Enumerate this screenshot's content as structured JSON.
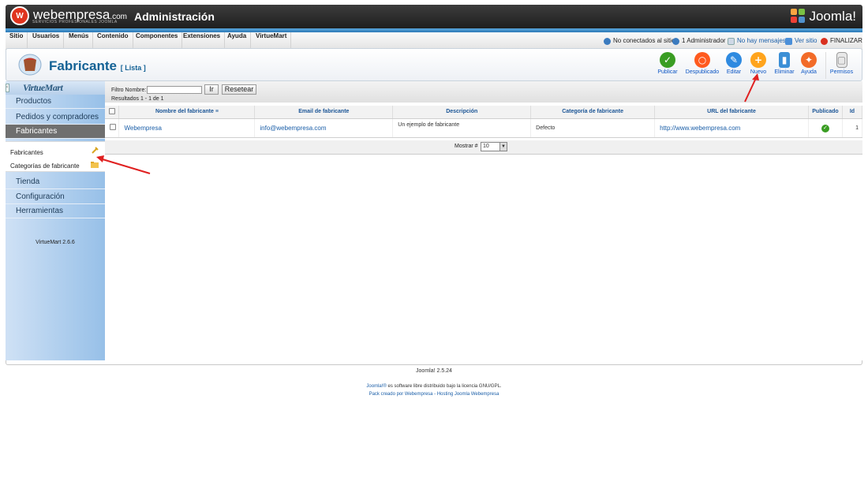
{
  "header": {
    "logo_mark": "W",
    "logo_name": "webempresa",
    "logo_suffix": ".com",
    "logo_sub": "SERVICIOS PROFESIONALES JOOMLA",
    "admin_title": "Administración",
    "joomla_logo": "Joomla!"
  },
  "menubar": {
    "items": [
      "Sitio",
      "Usuarios",
      "Menús",
      "Contenido",
      "Componentes",
      "Extensiones",
      "Ayuda",
      "VirtueMart"
    ],
    "status": {
      "visitors": "No conectados al sitio",
      "admins": "1 Administrador",
      "messages": "No hay mensajes",
      "view_site": "Ver sitio",
      "logout": "FINALIZAR"
    }
  },
  "toolbar": {
    "title": "Fabricante",
    "subtitle": "[ Lista ]",
    "buttons": {
      "publish": "Publicar",
      "unpublish": "Despublicado",
      "edit": "Editar",
      "new": "Nuevo",
      "delete": "Eliminar",
      "help": "Ayuda",
      "permissions": "Permisos"
    }
  },
  "sidebar": {
    "logo": "VirtueMart",
    "items": [
      "Productos",
      "Pedidos y compradores",
      "Fabricantes"
    ],
    "submenu": [
      "Fabricantes",
      "Categorías de fabricante"
    ],
    "items_after": [
      "Tienda",
      "Configuración",
      "Herramientas"
    ],
    "version": "VirtueMart 2.6.6"
  },
  "filter": {
    "label": "Filtro Nombre:",
    "value": "",
    "go_label": "Ir",
    "reset_label": "Resetear",
    "results": "Resultados 1 - 1 de 1"
  },
  "table": {
    "headers": [
      "Nombre del fabricante",
      "Email de fabricante",
      "Descripción",
      "Categoría de fabricante",
      "URL del fabricante",
      "Publicado",
      "Id"
    ],
    "rows": [
      {
        "name": "Webempresa",
        "email": "info@webempresa.com",
        "description": "Un ejemplo de fabricante",
        "category": "Defecto",
        "url": "http://www.webempresa.com",
        "published": "✓",
        "id": "1"
      }
    ]
  },
  "pagination": {
    "show_label": "Mostrar #",
    "limit": "10"
  },
  "footer": {
    "version": "Joomla! 2.5.24",
    "license_link": "Joomla!®",
    "license_text": " es software libre distribuido bajo la licencia GNU/GPL.",
    "credit": "Pack creado por Webempresa - Hosting Joomla Webempresa"
  },
  "colors": {
    "accent_blue": "#146295",
    "annotation_red": "#e02020",
    "publish_green": "#3a9d23",
    "unpublish_orange": "#ff5a1e",
    "edit_blue": "#2e8ae0",
    "new_orange": "#ffa41c",
    "delete_blue": "#3b8fd6",
    "help_orange": "#f26b28"
  }
}
